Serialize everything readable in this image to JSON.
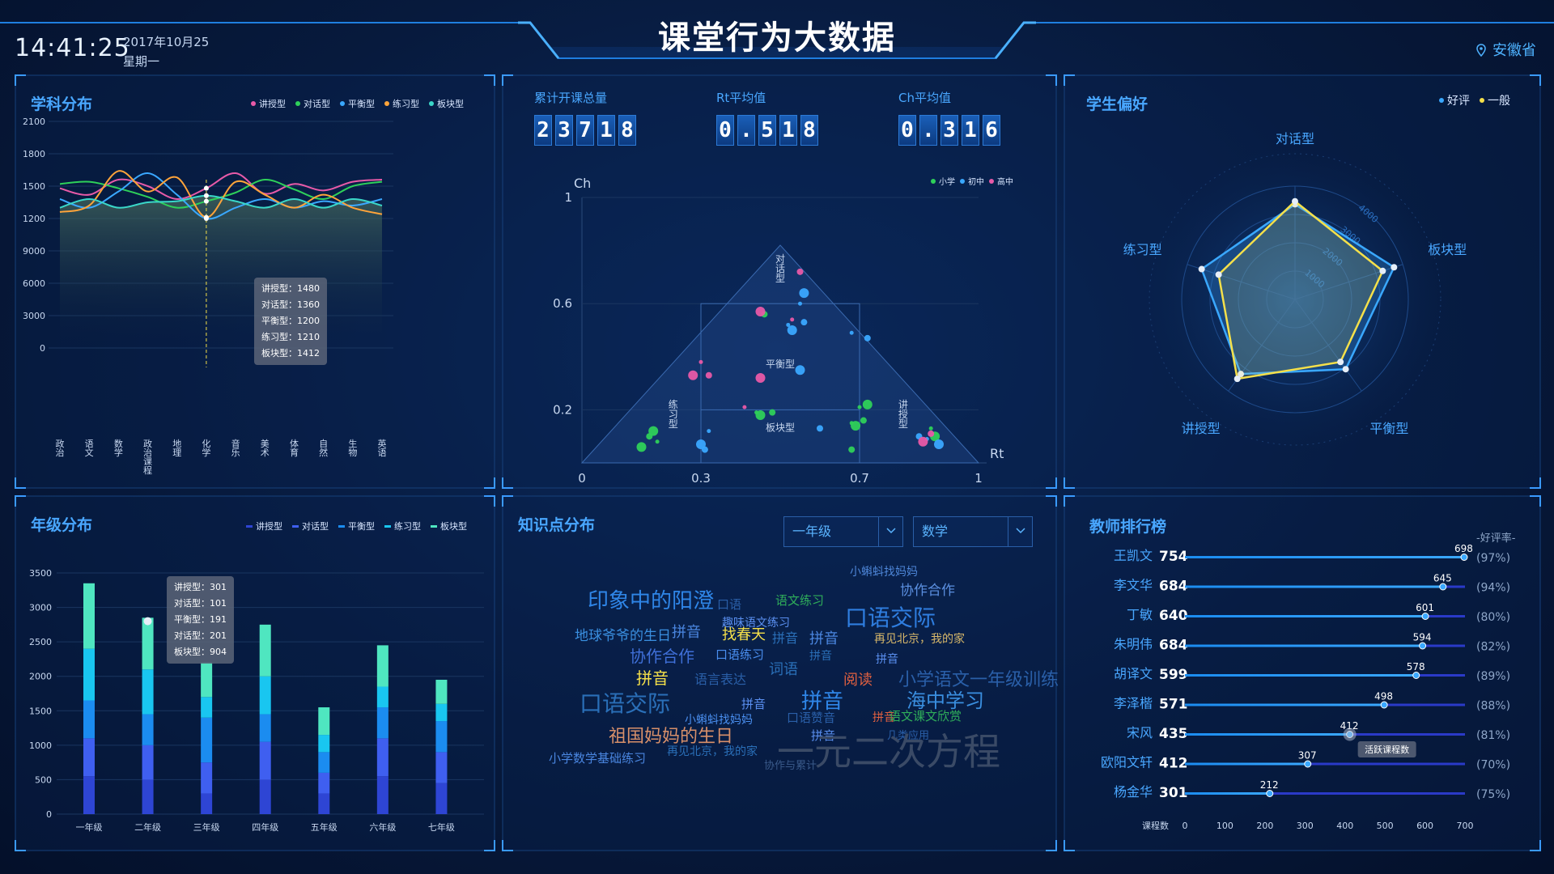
{
  "header": {
    "title": "课堂行为大数据",
    "time": "14:41:25",
    "date": "2017年10月25",
    "weekday": "星期一",
    "location": "安徽省"
  },
  "colors": {
    "accent": "#49a7ff",
    "pink": "#e85aa8",
    "green": "#2ed05a",
    "blue": "#3aa8ff",
    "orange": "#ffa43a",
    "teal": "#3ad7c8",
    "yellow": "#f5e04a"
  },
  "subject": {
    "title": "学科分布",
    "legend": [
      "讲授型",
      "对话型",
      "平衡型",
      "练习型",
      "板块型"
    ],
    "legend_colors": [
      "#e85aa8",
      "#2ed05a",
      "#3aa8ff",
      "#ffa43a",
      "#3ad7c8"
    ],
    "tooltip": [
      "讲授型：1480",
      "对话型：1360",
      "平衡型：1200",
      "练习型：1210",
      "板块型：1412"
    ]
  },
  "counters": {
    "total_label": "累计开课总量",
    "total_digits": [
      "2",
      "3",
      "7",
      "1",
      "8"
    ],
    "rt_label": "Rt平均值",
    "rt_digits": [
      "0",
      ".",
      "5",
      "1",
      "8"
    ],
    "ch_label": "Ch平均值",
    "ch_digits": [
      "0",
      ".",
      "3",
      "1",
      "6"
    ]
  },
  "triangle": {
    "legend": [
      "小学",
      "初中",
      "高中"
    ],
    "legend_colors": [
      "#2ed05a",
      "#3aa8ff",
      "#e85aa8"
    ],
    "ch_axis": "Ch",
    "rt_axis": "Rt",
    "y_ticks": [
      "1",
      "0.6",
      "0.2"
    ],
    "x_ticks": [
      "0",
      "0.3",
      "0.7",
      "1"
    ],
    "regions": [
      "对话型",
      "平衡型",
      "练习型",
      "板块型",
      "讲授型"
    ]
  },
  "preference": {
    "title": "学生偏好",
    "legend": [
      "好评",
      "一般"
    ],
    "legend_colors": [
      "#3aa8ff",
      "#f5e04a"
    ],
    "axes": [
      "对话型",
      "板块型",
      "平衡型",
      "讲授型",
      "练习型"
    ],
    "ring_labels": [
      "4000",
      "3000",
      "2000",
      "1000"
    ]
  },
  "grade": {
    "title": "年级分布",
    "legend": [
      "讲授型",
      "对话型",
      "平衡型",
      "练习型",
      "板块型"
    ],
    "legend_colors": [
      "#2e45d4",
      "#3f5ff0",
      "#1b8cf0",
      "#19c6f0",
      "#4fe6c0"
    ],
    "tooltip": [
      "讲授型：301",
      "对话型：101",
      "平衡型：191",
      "对话型：201",
      "板块型：904"
    ]
  },
  "knowledge": {
    "title": "知识点分布",
    "grade_select": "一年级",
    "subject_select": "数学",
    "words": [
      {
        "text": "小蝌蚪找妈妈",
        "size": 14,
        "color": "#4e86d8"
      },
      {
        "text": "印象中的阳澄",
        "size": 26,
        "color": "#2f86e8"
      },
      {
        "text": "口语",
        "size": 15,
        "color": "#2a5fa8"
      },
      {
        "text": "语文练习",
        "size": 15,
        "color": "#2fae5a"
      },
      {
        "text": "协作合作",
        "size": 17,
        "color": "#5b8fe0"
      },
      {
        "text": "趣味语文练习",
        "size": 14,
        "color": "#5a8ff0"
      },
      {
        "text": "口语交际",
        "size": 28,
        "color": "#2f7ee0"
      },
      {
        "text": "拼音",
        "size": 18,
        "color": "#4a86e0"
      },
      {
        "text": "找春天",
        "size": 18,
        "color": "#f5e04a"
      },
      {
        "text": "地球爷爷的生日",
        "size": 17,
        "color": "#3a8fe0"
      },
      {
        "text": "拼音",
        "size": 16,
        "color": "#2a6fb8"
      },
      {
        "text": "拼音",
        "size": 18,
        "color": "#4a86e0"
      },
      {
        "text": "再见北京，我的家",
        "size": 14,
        "color": "#d8b86a"
      },
      {
        "text": "协作合作",
        "size": 20,
        "color": "#3f6fd8"
      },
      {
        "text": "口语练习",
        "size": 15,
        "color": "#4a8ff0"
      },
      {
        "text": "拼音",
        "size": 14,
        "color": "#2a6fb8"
      },
      {
        "text": "拼音",
        "size": 14,
        "color": "#5a8ff0"
      },
      {
        "text": "词语",
        "size": 18,
        "color": "#2a6fb8"
      },
      {
        "text": "拼音",
        "size": 20,
        "color": "#f5e04a"
      },
      {
        "text": "语言表达",
        "size": 16,
        "color": "#2a5fa8"
      },
      {
        "text": "阅读",
        "size": 18,
        "color": "#e06040"
      },
      {
        "text": "小学语文一年级训练",
        "size": 22,
        "color": "#2a5fa8"
      },
      {
        "text": "口语交际",
        "size": 28,
        "color": "#2a6fb8"
      },
      {
        "text": "拼音",
        "size": 15,
        "color": "#5a8ff0"
      },
      {
        "text": "拼音",
        "size": 26,
        "color": "#2f86e8"
      },
      {
        "text": "海中学习",
        "size": 24,
        "color": "#3a8fe0"
      },
      {
        "text": "口语赞音",
        "size": 15,
        "color": "#2a5fa8"
      },
      {
        "text": "拼音",
        "size": 14,
        "color": "#e06040"
      },
      {
        "text": "小蝌蚪找妈妈",
        "size": 14,
        "color": "#4a8ff0"
      },
      {
        "text": "拼音",
        "size": 15,
        "color": "#5a8ff0"
      },
      {
        "text": "几类应用",
        "size": 13,
        "color": "#2a5fa8"
      },
      {
        "text": "语文课文欣赏",
        "size": 15,
        "color": "#2fae5a"
      },
      {
        "text": "祖国妈妈的生日",
        "size": 22,
        "color": "#d8906a"
      },
      {
        "text": "再见北京，我的家",
        "size": 14,
        "color": "#2a6fb8"
      },
      {
        "text": "一元二次方程",
        "size": 46,
        "color": "#3a4a66"
      },
      {
        "text": "小学数学基础练习",
        "size": 15,
        "color": "#4a86e0"
      },
      {
        "text": "协作与累计",
        "size": 13,
        "color": "#3a5a8a"
      }
    ]
  },
  "ranking": {
    "title": "教师排行榜",
    "rate_header": "-好评率-",
    "axis_label": "课程数",
    "x_ticks": [
      "0",
      "100",
      "200",
      "300",
      "400",
      "500",
      "600",
      "700"
    ],
    "hover_tip": "活跃课程数",
    "rows": [
      {
        "name": "王凯文",
        "score": "754",
        "value": 698,
        "label": "698",
        "rate": "(97%)"
      },
      {
        "name": "李文华",
        "score": "684",
        "value": 645,
        "label": "645",
        "rate": "(94%)"
      },
      {
        "name": "丁敏",
        "score": "640",
        "value": 601,
        "label": "601",
        "rate": "(80%)"
      },
      {
        "name": "朱明伟",
        "score": "684",
        "value": 594,
        "label": "594",
        "rate": "(82%)"
      },
      {
        "name": "胡译文",
        "score": "599",
        "value": 578,
        "label": "578",
        "rate": "(89%)"
      },
      {
        "name": "李泽楷",
        "score": "571",
        "value": 498,
        "label": "498",
        "rate": "(88%)"
      },
      {
        "name": "宋风",
        "score": "435",
        "value": 412,
        "label": "412",
        "rate": "(81%)"
      },
      {
        "name": "欧阳文轩",
        "score": "412",
        "value": 307,
        "label": "307",
        "rate": "(70%)"
      },
      {
        "name": "杨金华",
        "score": "301",
        "value": 212,
        "label": "212",
        "rate": "(75%)"
      }
    ]
  },
  "chart_data": [
    {
      "type": "line",
      "title": "学科分布",
      "categories": [
        "政治",
        "语文",
        "数学",
        "政治课程",
        "地理",
        "化学",
        "音乐",
        "美术",
        "体育",
        "自然",
        "生物",
        "英语"
      ],
      "y_ticks": [
        "0",
        "3000",
        "6000",
        "9000",
        "1200",
        "1500",
        "1800",
        "2100"
      ],
      "series": [
        {
          "name": "讲授型",
          "values": [
            1480,
            1420,
            1560,
            1500,
            1380,
            1480,
            1620,
            1430,
            1520,
            1460,
            1540,
            1560
          ]
        },
        {
          "name": "对话型",
          "values": [
            1520,
            1540,
            1480,
            1400,
            1300,
            1360,
            1440,
            1560,
            1470,
            1380,
            1500,
            1540
          ]
        },
        {
          "name": "平衡型",
          "values": [
            1380,
            1300,
            1450,
            1620,
            1420,
            1200,
            1300,
            1380,
            1300,
            1360,
            1320,
            1380
          ]
        },
        {
          "name": "练习型",
          "values": [
            1260,
            1320,
            1640,
            1450,
            1580,
            1210,
            1540,
            1420,
            1300,
            1420,
            1300,
            1240
          ]
        },
        {
          "name": "板块型",
          "values": [
            1300,
            1380,
            1300,
            1350,
            1360,
            1412,
            1360,
            1300,
            1380,
            1300,
            1380,
            1320
          ]
        }
      ]
    },
    {
      "type": "scatter",
      "title": "",
      "xlabel": "Rt",
      "ylabel": "Ch",
      "xlim": [
        0,
        1
      ],
      "ylim": [
        0,
        1
      ],
      "series": [
        {
          "name": "小学",
          "points": [
            [
              0.18,
              0.12
            ],
            [
              0.17,
              0.1
            ],
            [
              0.19,
              0.08
            ],
            [
              0.15,
              0.06
            ],
            [
              0.46,
              0.56
            ],
            [
              0.44,
              0.19
            ],
            [
              0.45,
              0.18
            ],
            [
              0.48,
              0.19
            ],
            [
              0.68,
              0.15
            ],
            [
              0.69,
              0.14
            ],
            [
              0.71,
              0.16
            ],
            [
              0.7,
              0.21
            ],
            [
              0.72,
              0.22
            ],
            [
              0.68,
              0.05
            ],
            [
              0.88,
              0.13
            ],
            [
              0.89,
              0.1
            ]
          ]
        },
        {
          "name": "初中",
          "points": [
            [
              0.3,
              0.07
            ],
            [
              0.31,
              0.05
            ],
            [
              0.52,
              0.52
            ],
            [
              0.53,
              0.5
            ],
            [
              0.56,
              0.53
            ],
            [
              0.55,
              0.6
            ],
            [
              0.56,
              0.64
            ],
            [
              0.72,
              0.47
            ],
            [
              0.68,
              0.49
            ],
            [
              0.55,
              0.35
            ],
            [
              0.85,
              0.1
            ],
            [
              0.87,
              0.09
            ],
            [
              0.9,
              0.07
            ],
            [
              0.6,
              0.13
            ],
            [
              0.32,
              0.12
            ]
          ]
        },
        {
          "name": "高中",
          "points": [
            [
              0.28,
              0.33
            ],
            [
              0.32,
              0.33
            ],
            [
              0.41,
              0.21
            ],
            [
              0.45,
              0.57
            ],
            [
              0.55,
              0.72
            ],
            [
              0.53,
              0.54
            ],
            [
              0.86,
              0.08
            ],
            [
              0.88,
              0.11
            ],
            [
              0.3,
              0.38
            ],
            [
              0.45,
              0.32
            ]
          ]
        }
      ]
    },
    {
      "type": "radar",
      "title": "学生偏好",
      "axes": [
        "对话型",
        "板块型",
        "平衡型",
        "讲授型",
        "练习型"
      ],
      "max": 4000,
      "series": [
        {
          "name": "好评",
          "values": [
            3200,
            3500,
            2900,
            3100,
            3300
          ]
        },
        {
          "name": "一般",
          "values": [
            3300,
            3100,
            2600,
            3300,
            2700
          ]
        }
      ]
    },
    {
      "type": "bar",
      "title": "年级分布",
      "stacked": true,
      "categories": [
        "一年级",
        "二年级",
        "三年级",
        "四年级",
        "五年级",
        "六年级",
        "七年级"
      ],
      "y_ticks": [
        "0",
        "500",
        "1000",
        "1500",
        "2000",
        "2500",
        "3000",
        "3500"
      ],
      "ylim": [
        0,
        3500
      ],
      "series": [
        {
          "name": "讲授型",
          "values": [
            550,
            500,
            300,
            500,
            300,
            550,
            450
          ]
        },
        {
          "name": "对话型",
          "values": [
            550,
            500,
            450,
            550,
            300,
            550,
            450
          ]
        },
        {
          "name": "平衡型",
          "values": [
            550,
            450,
            650,
            400,
            300,
            450,
            450
          ]
        },
        {
          "name": "练习型",
          "values": [
            750,
            650,
            300,
            550,
            250,
            300,
            250
          ]
        },
        {
          "name": "板块型",
          "values": [
            950,
            750,
            500,
            750,
            400,
            600,
            350
          ]
        }
      ]
    },
    {
      "type": "bar",
      "title": "教师排行榜",
      "orientation": "horizontal",
      "xlabel": "课程数",
      "xlim": [
        0,
        700
      ],
      "categories": [
        "王凯文",
        "李文华",
        "丁敏",
        "朱明伟",
        "胡译文",
        "李泽楷",
        "宋风",
        "欧阳文轩",
        "杨金华"
      ],
      "values": [
        698,
        645,
        601,
        594,
        578,
        498,
        412,
        307,
        212
      ]
    }
  ]
}
